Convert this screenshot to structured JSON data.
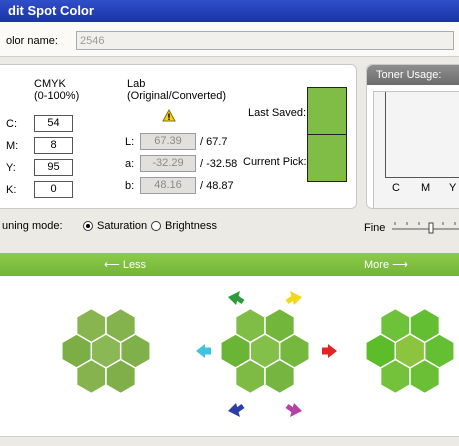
{
  "window": {
    "title": "dit Spot Color"
  },
  "name_row": {
    "label": "olor name:",
    "value": "2546"
  },
  "cmyk": {
    "heading": "CMYK",
    "range": "(0-100%)",
    "fields": [
      {
        "label": "C:",
        "value": "54"
      },
      {
        "label": "M:",
        "value": "8"
      },
      {
        "label": "Y:",
        "value": "95"
      },
      {
        "label": "K:",
        "value": "0"
      }
    ]
  },
  "lab": {
    "heading": "Lab",
    "sub": "(Original/Converted)",
    "warning_icon": "warning-triangle-icon",
    "rows": [
      {
        "label": "L:",
        "original": "67.39",
        "converted": "/ 67.7"
      },
      {
        "label": "a:",
        "original": "-32.29",
        "converted": "/ -32.58"
      },
      {
        "label": "b:",
        "original": "48.16",
        "converted": "/ 48.87"
      }
    ]
  },
  "swatches": {
    "last_saved": "Last Saved:",
    "current_pick": "Current Pick:",
    "color": "#7fbd47"
  },
  "toner": {
    "title": "Toner Usage:",
    "channels": [
      "C",
      "M",
      "Y"
    ]
  },
  "tuning": {
    "label": "uning mode:",
    "options": [
      {
        "label": "Saturation",
        "selected": true
      },
      {
        "label": "Brightness",
        "selected": false
      }
    ],
    "fine_label": "Fine"
  },
  "bar": {
    "less": "⟵  Less",
    "more": "More  ⟶"
  },
  "colors": {
    "bar_green": "#7fc143",
    "arrow_green": "#2e9a3c",
    "arrow_yellow": "#f1d81a",
    "arrow_cyan": "#3fc4de",
    "arrow_red": "#e12424",
    "arrow_blue": "#2c3fa6",
    "arrow_magenta": "#b442a8"
  },
  "clusters": [
    {
      "name": "less",
      "hexes": [
        "#88b550",
        "#84b24c",
        "#7bae45",
        "#8ab855",
        "#7fb049",
        "#86b34e",
        "#80ae48"
      ]
    },
    {
      "name": "current",
      "hexes": [
        "#7fbd47",
        "#72b63b",
        "#6bb536",
        "#82c049",
        "#75b83e",
        "#7ebb45",
        "#76b640"
      ]
    },
    {
      "name": "more",
      "hexes": [
        "#6ec23a",
        "#63be31",
        "#5cbc2a",
        "#8cc43f",
        "#65bf33",
        "#74c13b",
        "#6abf36"
      ]
    }
  ]
}
